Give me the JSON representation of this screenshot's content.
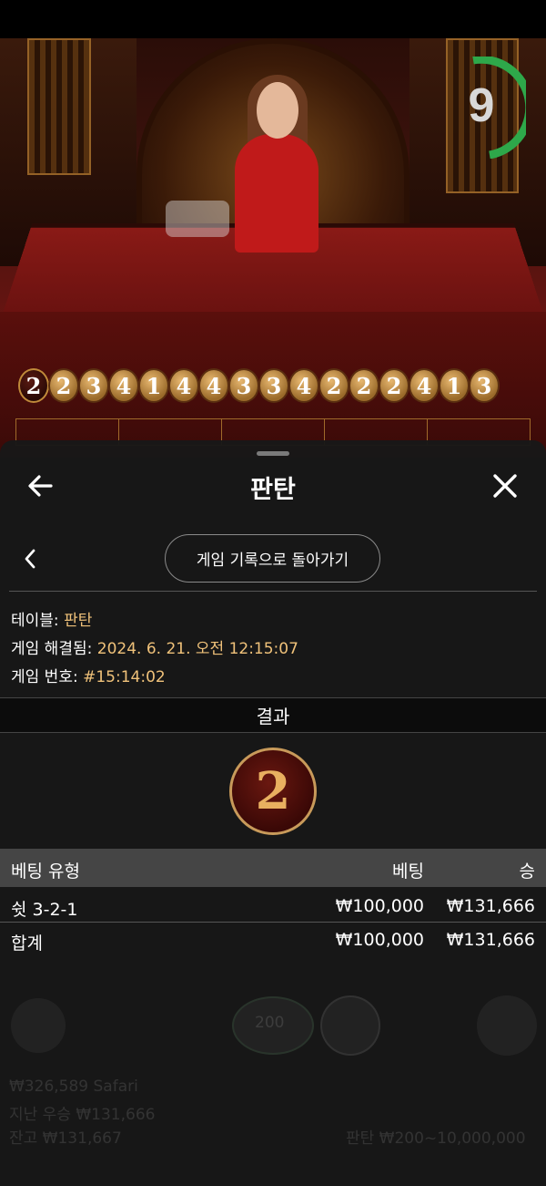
{
  "road": [
    "2",
    "2",
    "3",
    "4",
    "1",
    "4",
    "4",
    "3",
    "3",
    "4",
    "2",
    "2",
    "2",
    "4",
    "1",
    "3"
  ],
  "timer": {
    "value": "9",
    "progress": 0.62
  },
  "sheet": {
    "title": "판탄",
    "back_to_history": "게임 기록으로 돌아가기",
    "info": {
      "table_label": "테이블:",
      "table_value": "판탄",
      "resolved_label": "게임 해결됨:",
      "resolved_value": "2024. 6. 21. 오전 12:15:07",
      "game_no_label": "게임 번호:",
      "game_no_value": "#15:14:02"
    },
    "result_label": "결과",
    "result_value": "2",
    "table": {
      "headers": [
        "베팅 유형",
        "베팅",
        "승"
      ],
      "rows": [
        {
          "type": "쉿 3-2-1",
          "bet": "₩100,000",
          "win": "₩131,666"
        }
      ],
      "total": {
        "label": "합계",
        "bet": "₩100,000",
        "win": "₩131,666"
      }
    }
  },
  "background": {
    "balance_line1": "₩326,589 Safari",
    "balance_line2": "지난 우승 ₩131,666",
    "balance_line3": "잔고 ₩131,667",
    "limit": "판탄 ₩200~10,000,000",
    "chip_value": "200"
  }
}
